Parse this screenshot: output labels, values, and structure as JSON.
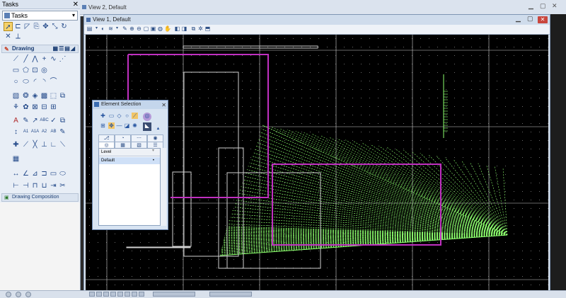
{
  "tasks": {
    "title": "Tasks",
    "close": "✕",
    "selected_task": "Tasks",
    "tool_icons_top": [
      "select-arrow-icon",
      "place-fence-icon",
      "modify-icon",
      "copy-icon",
      "move-icon",
      "scale-icon",
      "rotate-icon",
      "delete-icon",
      "measure-icon"
    ],
    "drawing_label": "Drawing",
    "drawing_composition_label": "Drawing Composition",
    "drawing_tools": [
      "place-smartline-icon",
      "place-line-icon",
      "place-stream-icon",
      "place-point-icon",
      "place-curve-icon",
      "place-spline-icon",
      "place-block-icon",
      "place-shape-icon",
      "place-orthogonal-icon",
      "place-circle-icon",
      "place-ellipse-icon",
      "place-arc-icon",
      "place-half-ellipse-icon",
      "place-quarter-ellipse-icon",
      "place-arc-by-edge-icon",
      "hatch-icon",
      "pattern-icon",
      "fill-icon",
      "crosshatch-icon",
      "area-icon",
      "copy-area-icon",
      "place-cell-icon",
      "place-cell-2-icon",
      "select-cell-icon",
      "cell-library-icon",
      "define-cell-icon",
      "place-text-icon",
      "edit-text-icon",
      "place-note-icon",
      "text-abc-icon",
      "spell-icon",
      "copy-text-icon",
      "increment-text-icon",
      "place-node-icon",
      "text-a1a-icon",
      "text-a2-icon",
      "text-abc-2-icon",
      "text-node-icon",
      "snap-icon",
      "construct-icon",
      "intersect-icon",
      "tangent-icon",
      "perpendicular-icon",
      "segment-icon",
      "grid-icon",
      "dimension-linear-icon",
      "dimension-angle-icon",
      "dimension-radial-icon",
      "dimension-ordinate-icon",
      "dimension-element-icon",
      "dimension-callout-icon",
      "match-icon",
      "change-icon",
      "drop-icon",
      "partial-delete-icon",
      "extend-icon",
      "trim-icon"
    ]
  },
  "view2": {
    "title": "View 2, Default"
  },
  "view1": {
    "title": "View 1, Default",
    "toolbar_icons": [
      "view-attributes-icon",
      "display-style-icon",
      "levels-icon",
      "update-icon",
      "zoom-in-icon",
      "zoom-out-icon",
      "window-area-icon",
      "fit-view-icon",
      "rotate-view-icon",
      "pan-icon",
      "previous-view-icon",
      "next-view-icon",
      "copy-view-icon",
      "camera-icon",
      "clip-volume-icon",
      "clip-mask-icon"
    ]
  },
  "element_selection": {
    "title": "Element Selection",
    "close": "✕",
    "list_header": "Level",
    "list_rows": [
      {
        "name": "Default",
        "marker": "•"
      }
    ]
  },
  "colors": {
    "canvas_bg": "#000000",
    "grid_line": "#cfcfcf",
    "magenta": "#c030c0",
    "green_lines": "#8cff6e",
    "panel_bg": "#e8eef6"
  }
}
